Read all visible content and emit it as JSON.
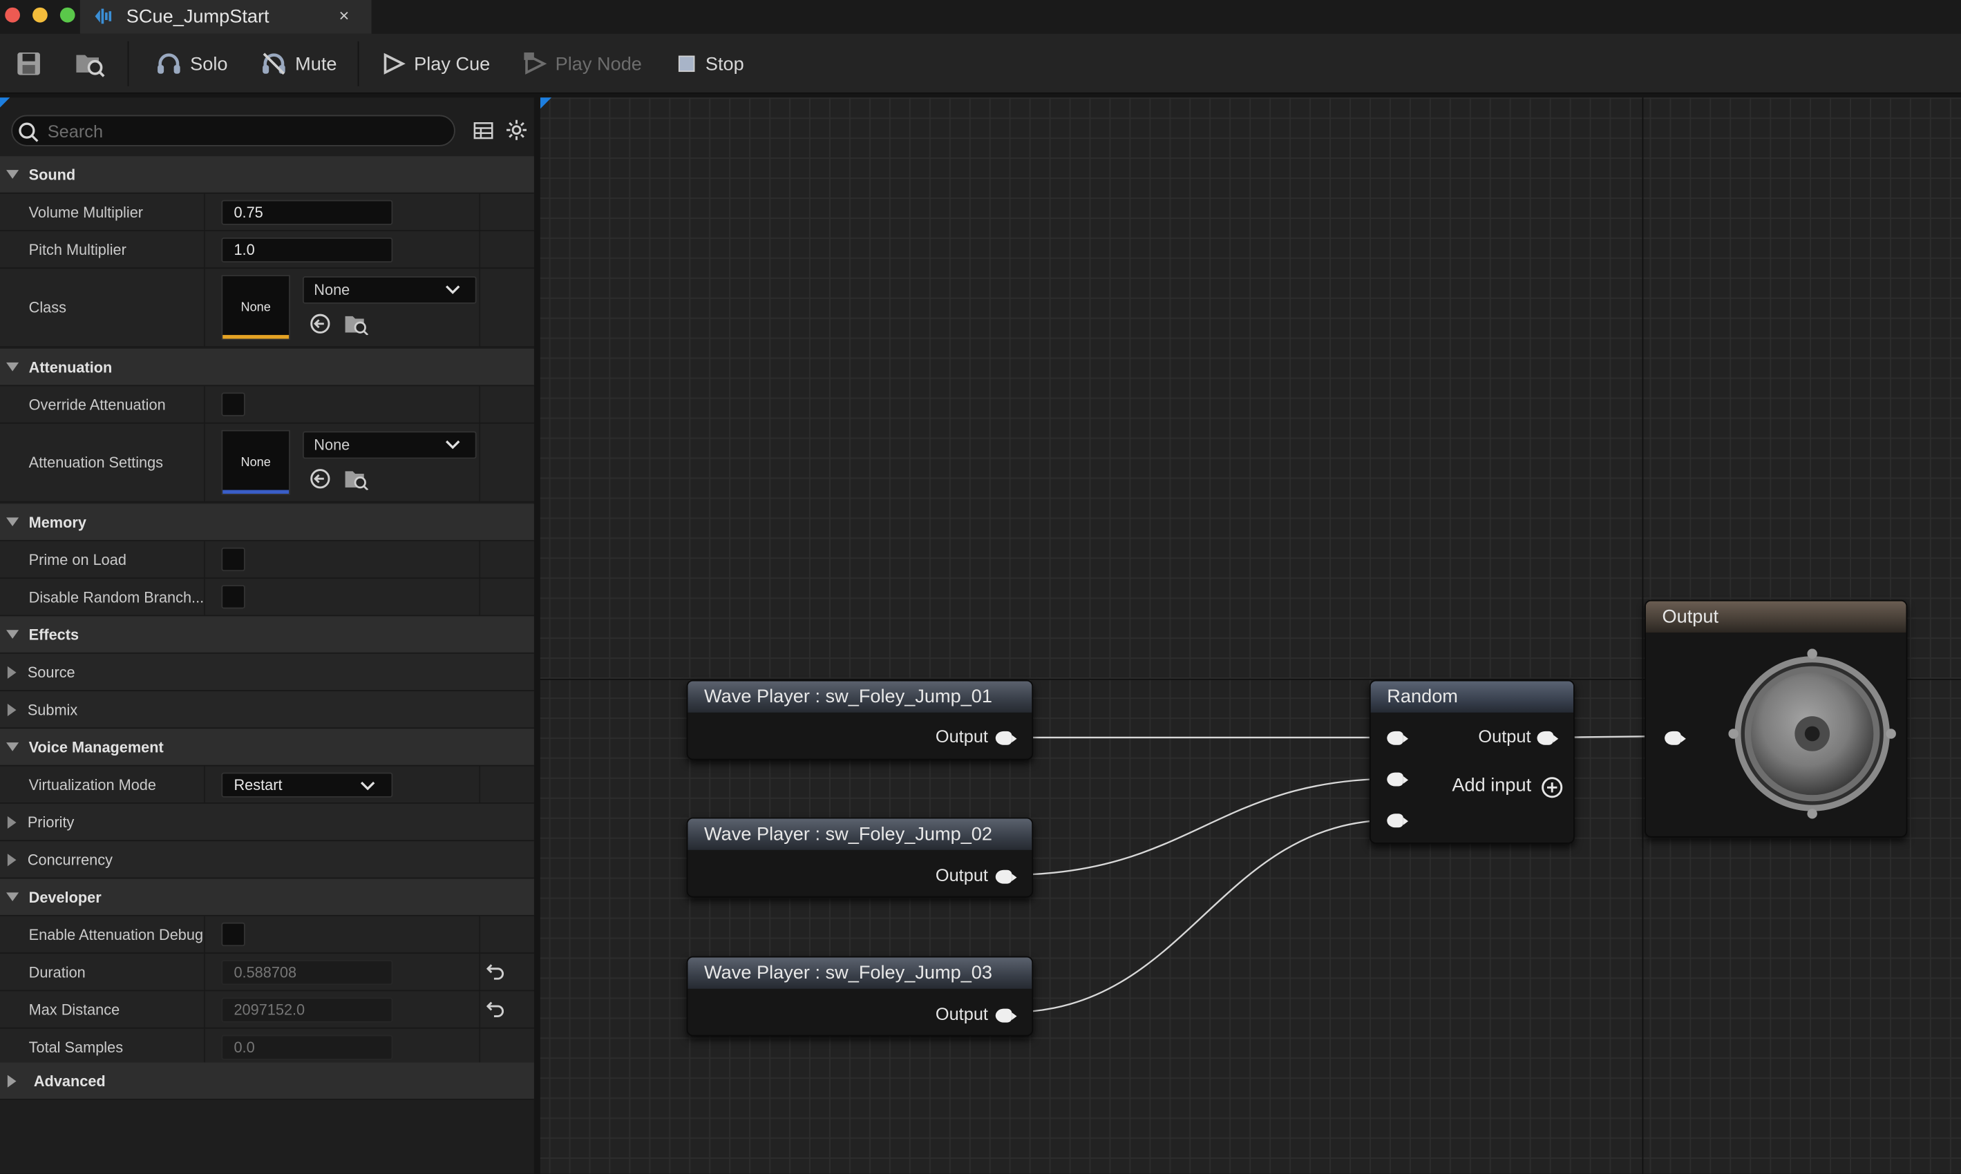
{
  "window": {
    "tab_title": "SCue_JumpStart",
    "close_glyph": "×"
  },
  "toolbar": {
    "solo": "Solo",
    "mute": "Mute",
    "play_cue": "Play Cue",
    "play_node": "Play Node",
    "stop": "Stop"
  },
  "details": {
    "search_placeholder": "Search",
    "sound": {
      "header": "Sound",
      "volume_label": "Volume Multiplier",
      "volume_value": "0.75",
      "pitch_label": "Pitch Multiplier",
      "pitch_value": "1.0",
      "class_label": "Class",
      "class_thumb": "None",
      "class_combo": "None"
    },
    "attenuation": {
      "header": "Attenuation",
      "override_label": "Override Attenuation",
      "settings_label": "Attenuation Settings",
      "settings_thumb": "None",
      "settings_combo": "None"
    },
    "memory": {
      "header": "Memory",
      "prime_label": "Prime on Load",
      "disable_label": "Disable Random Branch..."
    },
    "effects": {
      "header": "Effects",
      "source": "Source",
      "submix": "Submix"
    },
    "voice": {
      "header": "Voice Management",
      "virt_label": "Virtualization Mode",
      "virt_value": "Restart",
      "priority": "Priority",
      "concurrency": "Concurrency"
    },
    "developer": {
      "header": "Developer",
      "debug_label": "Enable Attenuation Debug",
      "duration_label": "Duration",
      "duration_value": "0.588708",
      "maxdist_label": "Max Distance",
      "maxdist_value": "2097152.0",
      "samples_label": "Total Samples",
      "samples_value": "0.0"
    },
    "advanced": "Advanced"
  },
  "graph": {
    "wave_nodes": [
      {
        "title": "Wave Player : sw_Foley_Jump_01",
        "output": "Output"
      },
      {
        "title": "Wave Player : sw_Foley_Jump_02",
        "output": "Output"
      },
      {
        "title": "Wave Player : sw_Foley_Jump_03",
        "output": "Output"
      }
    ],
    "random_node": {
      "title": "Random",
      "output": "Output",
      "add_input": "Add input"
    },
    "output_node": {
      "title": "Output"
    }
  },
  "colors": {
    "class_accent": "#e5a324",
    "attenuation_accent": "#3a5ec8"
  }
}
